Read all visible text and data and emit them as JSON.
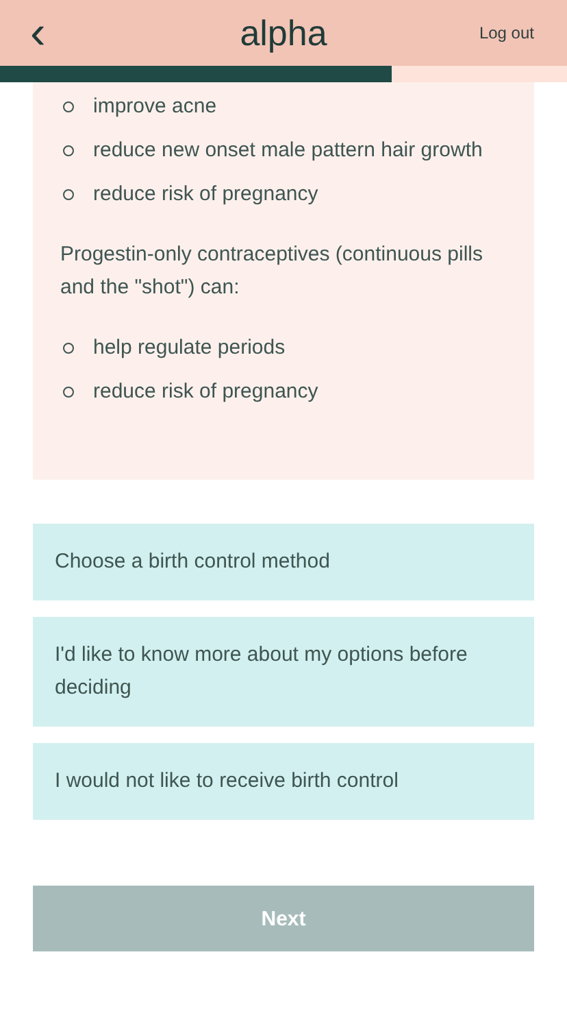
{
  "header": {
    "back": "‹",
    "logo": "alpha",
    "logout": "Log out"
  },
  "progress": {
    "level": 0.69
  },
  "info": {
    "bullets_1": [
      "improve acne",
      "reduce new onset male pattern hair growth",
      "reduce risk of pregnancy"
    ],
    "paragraph": "Progestin-only contraceptives (continuous pills and the \"shot\") can:",
    "bullets_2": [
      "help regulate periods",
      "reduce risk of pregnancy"
    ]
  },
  "options": [
    {
      "label": "Choose a birth control method",
      "selected": false
    },
    {
      "label": "I'd like to know more about my options before deciding",
      "selected": false
    },
    {
      "label": "I would not like to receive birth control",
      "selected": false
    }
  ],
  "next_button": {
    "label": "Next",
    "disabled": true
  }
}
